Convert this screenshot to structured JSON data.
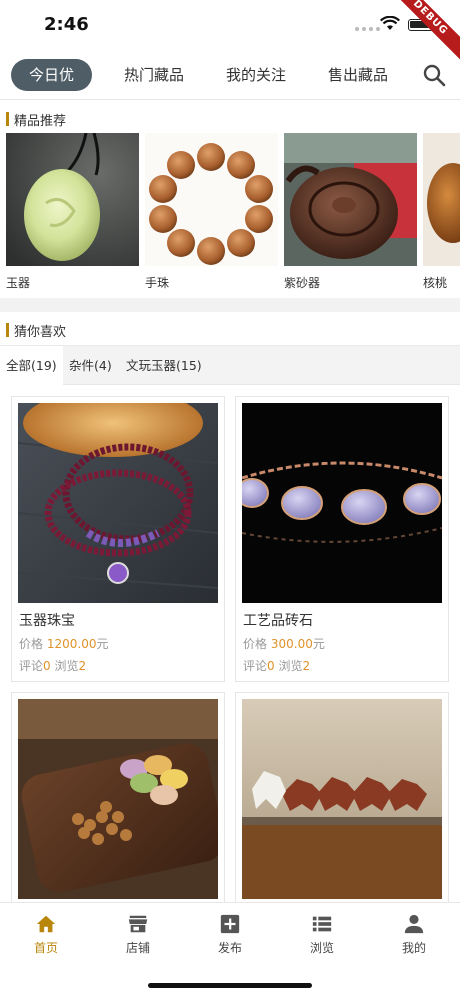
{
  "status": {
    "time": "2:46",
    "ribbon": "DEBUG"
  },
  "top_tabs": [
    {
      "label": "今日优选",
      "active": true
    },
    {
      "label": "热门藏品",
      "active": false
    },
    {
      "label": "我的关注",
      "active": false
    },
    {
      "label": "售出藏品",
      "active": false
    }
  ],
  "featured": {
    "title": "精品推荐",
    "items": [
      {
        "label": "玉器",
        "image": "jade-pendant"
      },
      {
        "label": "手珠",
        "image": "wood-bead-bracelet"
      },
      {
        "label": "紫砂器",
        "image": "zisha-teapot"
      },
      {
        "label": "核桃",
        "image": "walnut"
      }
    ]
  },
  "guess": {
    "title": "猜你喜欢",
    "filters": [
      {
        "label": "全部(19)",
        "active": true
      },
      {
        "label": "杂件(4)",
        "active": false
      },
      {
        "label": "文玩玉器(15)",
        "active": false
      }
    ]
  },
  "products": [
    {
      "name": "玉器珠宝",
      "price_label": "价格",
      "price": "1200.00",
      "unit": "元",
      "comment_label": "评论",
      "comments": "0",
      "view_label": "浏览",
      "views": "2",
      "image": "garnet-bracelet"
    },
    {
      "name": "工艺品砖石",
      "price_label": "价格",
      "price": "300.00",
      "unit": "元",
      "comment_label": "评论",
      "comments": "0",
      "view_label": "浏览",
      "views": "2",
      "image": "lavender-jade-bracelet"
    },
    {
      "name": "",
      "image": "macaron-tray"
    },
    {
      "name": "",
      "image": "horse-sculpture"
    }
  ],
  "bottom_nav": [
    {
      "label": "首页",
      "icon": "home-icon",
      "active": true
    },
    {
      "label": "店铺",
      "icon": "store-icon",
      "active": false
    },
    {
      "label": "发布",
      "icon": "add-box-icon",
      "active": false
    },
    {
      "label": "浏览",
      "icon": "list-icon",
      "active": false
    },
    {
      "label": "我的",
      "icon": "person-icon",
      "active": false
    }
  ],
  "colors": {
    "accent": "#b8860b",
    "price": "#e0922a",
    "active_tab_bg": "#4f5d66"
  }
}
